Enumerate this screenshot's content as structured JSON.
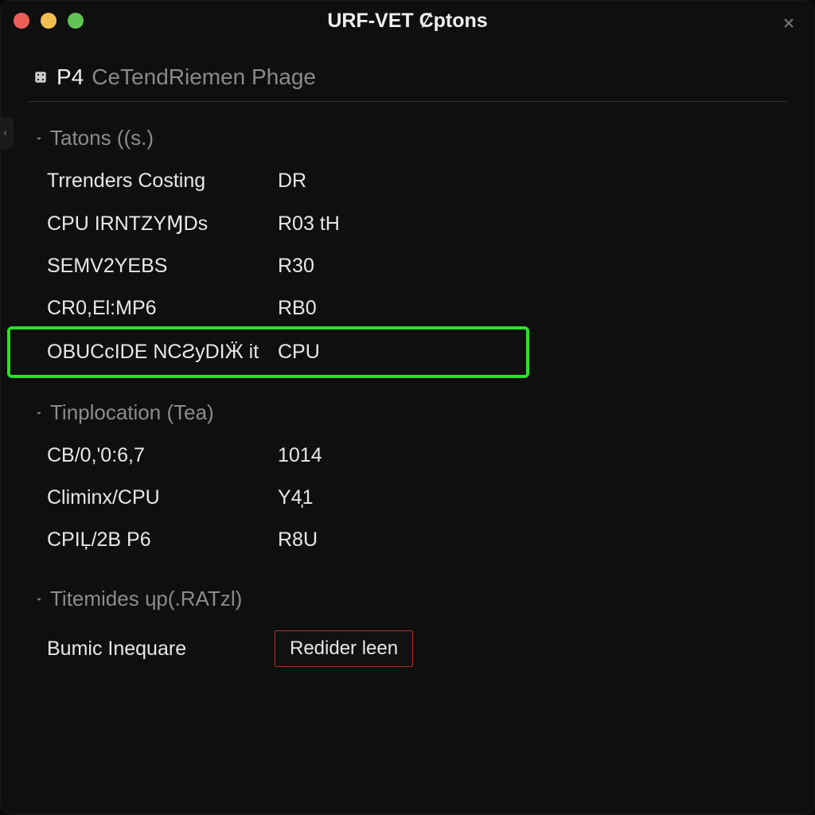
{
  "window": {
    "title": "URF-VET Ȼptons"
  },
  "page": {
    "prefix": "P4",
    "title": "CeTendRiemen Phage"
  },
  "sections": [
    {
      "title": "Tatons ((s.)",
      "rows": [
        {
          "label": "Trrenders Costing",
          "value": "DR",
          "highlighted": false
        },
        {
          "label": "CPU IRNTZYⱮDs",
          "value": "R03 tH",
          "highlighted": false
        },
        {
          "label": "SEMV2YEBS",
          "value": "R30",
          "highlighted": false
        },
        {
          "label": "CR0,El:MP6",
          "value": "RB0",
          "highlighted": false
        },
        {
          "label": "OBUCcIDE NCƧyDIӜ it",
          "value": "CPU",
          "highlighted": true
        }
      ]
    },
    {
      "title": "Tinplocation (Tea)",
      "rows": [
        {
          "label": "CB/0,'0:6,7",
          "value": "1014",
          "highlighted": false
        },
        {
          "label": "Climinx/CPU",
          "value": "Y4̩1",
          "highlighted": false
        },
        {
          "label": "CPIĻ/2B P6",
          "value": "R8U",
          "highlighted": false
        }
      ]
    },
    {
      "title": "Titemides ɥp(.RATzl)",
      "rows": [
        {
          "label": "Bumic Inequare",
          "value": "Redider leen",
          "highlighted": false,
          "button": true
        }
      ]
    }
  ],
  "colors": {
    "highlight": "#2be02b",
    "button_border": "#b03030"
  }
}
